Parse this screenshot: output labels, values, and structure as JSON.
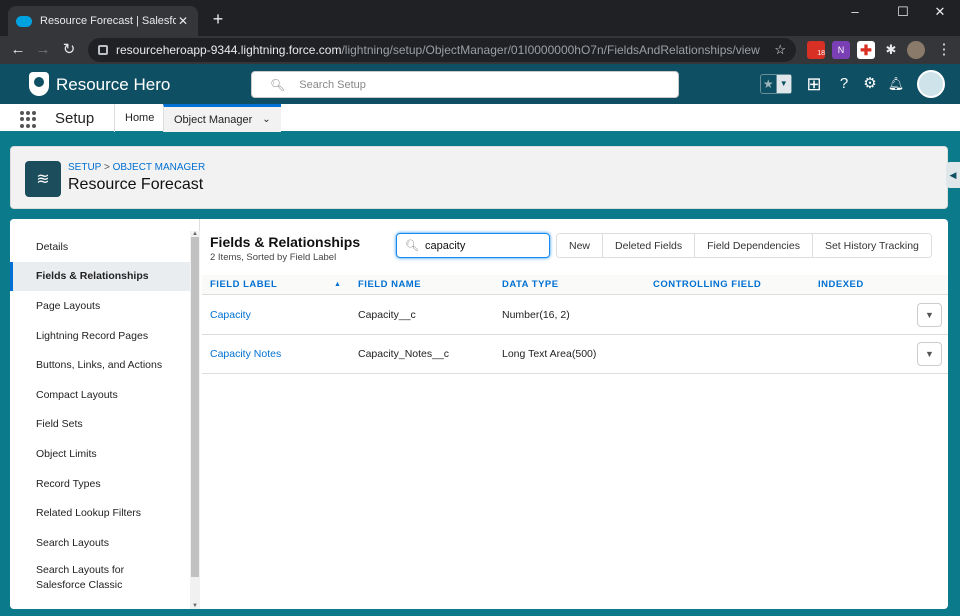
{
  "browser": {
    "tab_title": "Resource Forecast | Salesforce",
    "url_host": "resourceheroapp-9344.lightning.force.com",
    "url_path": "/lightning/setup/ObjectManager/01I0000000hO7n/FieldsAndRelationships/view",
    "ext_badge": "18"
  },
  "header": {
    "brand": "Resource Hero",
    "search_placeholder": "Search Setup"
  },
  "nav": {
    "app_name": "Setup",
    "tabs": [
      {
        "label": "Home"
      },
      {
        "label": "Object Manager"
      }
    ]
  },
  "page": {
    "breadcrumb": [
      "SETUP",
      "OBJECT MANAGER"
    ],
    "breadcrumb_sep": ">",
    "title": "Resource Forecast"
  },
  "sidebar": {
    "items": [
      {
        "label": "Details"
      },
      {
        "label": "Fields & Relationships",
        "active": true
      },
      {
        "label": "Page Layouts"
      },
      {
        "label": "Lightning Record Pages"
      },
      {
        "label": "Buttons, Links, and Actions"
      },
      {
        "label": "Compact Layouts"
      },
      {
        "label": "Field Sets"
      },
      {
        "label": "Object Limits"
      },
      {
        "label": "Record Types"
      },
      {
        "label": "Related Lookup Filters"
      },
      {
        "label": "Search Layouts"
      },
      {
        "label_line1": "Search Layouts for",
        "label_line2": "Salesforce Classic"
      }
    ]
  },
  "fields": {
    "title": "Fields & Relationships",
    "subtitle": "2 Items, Sorted by Field Label",
    "search_value": "capacity",
    "buttons": [
      "New",
      "Deleted Fields",
      "Field Dependencies",
      "Set History Tracking"
    ],
    "columns": [
      "FIELD LABEL",
      "FIELD NAME",
      "DATA TYPE",
      "CONTROLLING FIELD",
      "INDEXED"
    ],
    "rows": [
      {
        "label": "Capacity",
        "name": "Capacity__c",
        "type": "Number(16, 2)",
        "controlling": "",
        "indexed": ""
      },
      {
        "label": "Capacity Notes",
        "name": "Capacity_Notes__c",
        "type": "Long Text Area(500)",
        "controlling": "",
        "indexed": ""
      }
    ]
  },
  "colors": {
    "brand_bar": "#0f4f63",
    "page_bg": "#0b7a8b",
    "link": "#0070d2"
  }
}
